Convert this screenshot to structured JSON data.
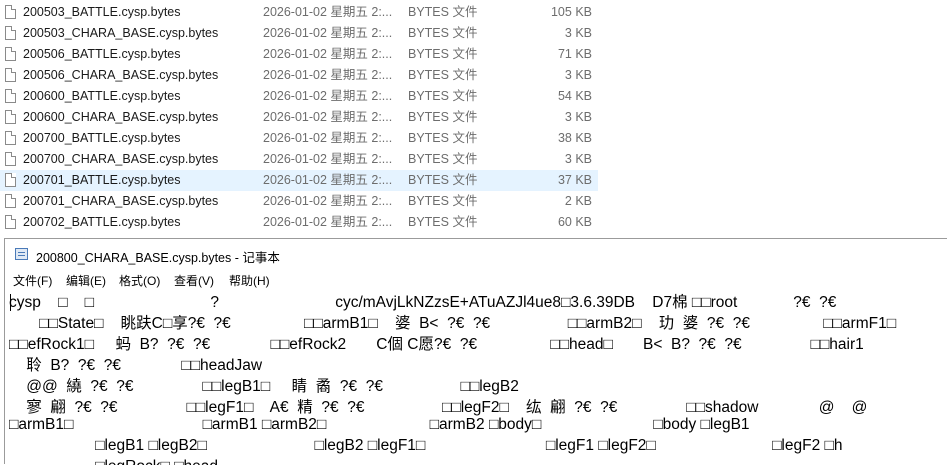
{
  "files": [
    {
      "name": "200503_BATTLE.cysp.bytes",
      "date": "2026-01-02 星期五 2:...",
      "type": "BYTES 文件",
      "size": "105 KB"
    },
    {
      "name": "200503_CHARA_BASE.cysp.bytes",
      "date": "2026-01-02 星期五 2:...",
      "type": "BYTES 文件",
      "size": "3 KB"
    },
    {
      "name": "200506_BATTLE.cysp.bytes",
      "date": "2026-01-02 星期五 2:...",
      "type": "BYTES 文件",
      "size": "71 KB"
    },
    {
      "name": "200506_CHARA_BASE.cysp.bytes",
      "date": "2026-01-02 星期五 2:...",
      "type": "BYTES 文件",
      "size": "3 KB"
    },
    {
      "name": "200600_BATTLE.cysp.bytes",
      "date": "2026-01-02 星期五 2:...",
      "type": "BYTES 文件",
      "size": "54 KB"
    },
    {
      "name": "200600_CHARA_BASE.cysp.bytes",
      "date": "2026-01-02 星期五 2:...",
      "type": "BYTES 文件",
      "size": "3 KB"
    },
    {
      "name": "200700_BATTLE.cysp.bytes",
      "date": "2026-01-02 星期五 2:...",
      "type": "BYTES 文件",
      "size": "38 KB"
    },
    {
      "name": "200700_CHARA_BASE.cysp.bytes",
      "date": "2026-01-02 星期五 2:...",
      "type": "BYTES 文件",
      "size": "3 KB"
    },
    {
      "name": "200701_BATTLE.cysp.bytes",
      "date": "2026-01-02 星期五 2:...",
      "type": "BYTES 文件",
      "size": "37 KB"
    },
    {
      "name": "200701_CHARA_BASE.cysp.bytes",
      "date": "2026-01-02 星期五 2:...",
      "type": "BYTES 文件",
      "size": "2 KB"
    },
    {
      "name": "200702_BATTLE.cysp.bytes",
      "date": "2026-01-02 星期五 2:...",
      "type": "BYTES 文件",
      "size": "60 KB"
    }
  ],
  "selected_file_index": 8,
  "notepad": {
    "title": "200800_CHARA_BASE.cysp.bytes - 记事本",
    "menu": [
      "文件(F)",
      "编辑(E)",
      "格式(O)",
      "查看(V)",
      "帮助(H)"
    ],
    "lines": [
      "cysp    □    □                           ?                           cyc/mAvjLkNZzsE+ATuAZJl4ue8□3.6.39DB    D7棉 □□root             ?€  ?€",
      "       □□State□    眺趺C□享?€  ?€                 □□armB1□    婆  B<  ?€  ?€                  □□armB2□    玏  婆  ?€  ?€                 □□armF1□",
      "□□efRock1□     蚂  B?  ?€  ?€              □□efRock2       C個 C愿?€  ?€                 □□head□       B<  B?  ?€  ?€                □□hair1",
      "    聆  B?  ?€  ?€              □□headJaw",
      "    @@  繞  ?€  ?€                □□legB1□     睛  矞  ?€  ?€                  □□legB2",
      "    寥  翩  ?€  ?€                □□legF1□    A€  精  ?€  ?€                  □□legF2□    纮  翩  ?€  ?€                □□shadow              @    @",
      "□armB1□                              □armB1 □armB2□                        □armB2 □body□                          □body □legB1",
      "                    □legB1 □legB2□                         □legB2 □legF1□                            □legF1 □legF2□                           □legF2 □h",
      "                    □legRock□ □head"
    ]
  }
}
